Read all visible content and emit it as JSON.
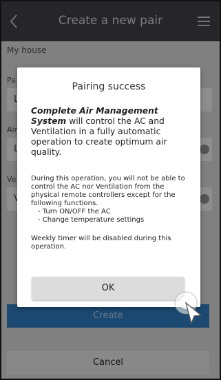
{
  "header": {
    "title": "Create a new pair",
    "back_icon": "chevron-left-icon",
    "menu_icon": "hamburger-menu-icon"
  },
  "form": {
    "house_name": "My house",
    "pair_label_partial": "Pa",
    "pair_value_partial": "L",
    "air_label_partial": "Air",
    "air_value_partial": "L",
    "vent_label_partial": "Ve",
    "vent_value_partial": "V"
  },
  "buttons": {
    "create_label": "Create",
    "cancel_label": "Cancel"
  },
  "dialog": {
    "title": "Pairing success",
    "lead_emphasis": "Complete Air Management System",
    "lead_rest": "will control the AC and Ventilation in a fully automatic operation to create optimum air quality.",
    "detail_intro": "During this operation, you will not be able to control the AC nor Ventilation from the physical remote controllers except for the following functions.",
    "detail_items": [
      "- Turn ON/OFF the AC",
      "- Change temperature settings"
    ],
    "note": "Weekly timer will be disabled during this operation.",
    "ok_label": "OK"
  },
  "colors": {
    "header_bg": "#3c3c44",
    "accent_blue": "#2d77b7",
    "screen_bg": "#cfcfcf"
  }
}
